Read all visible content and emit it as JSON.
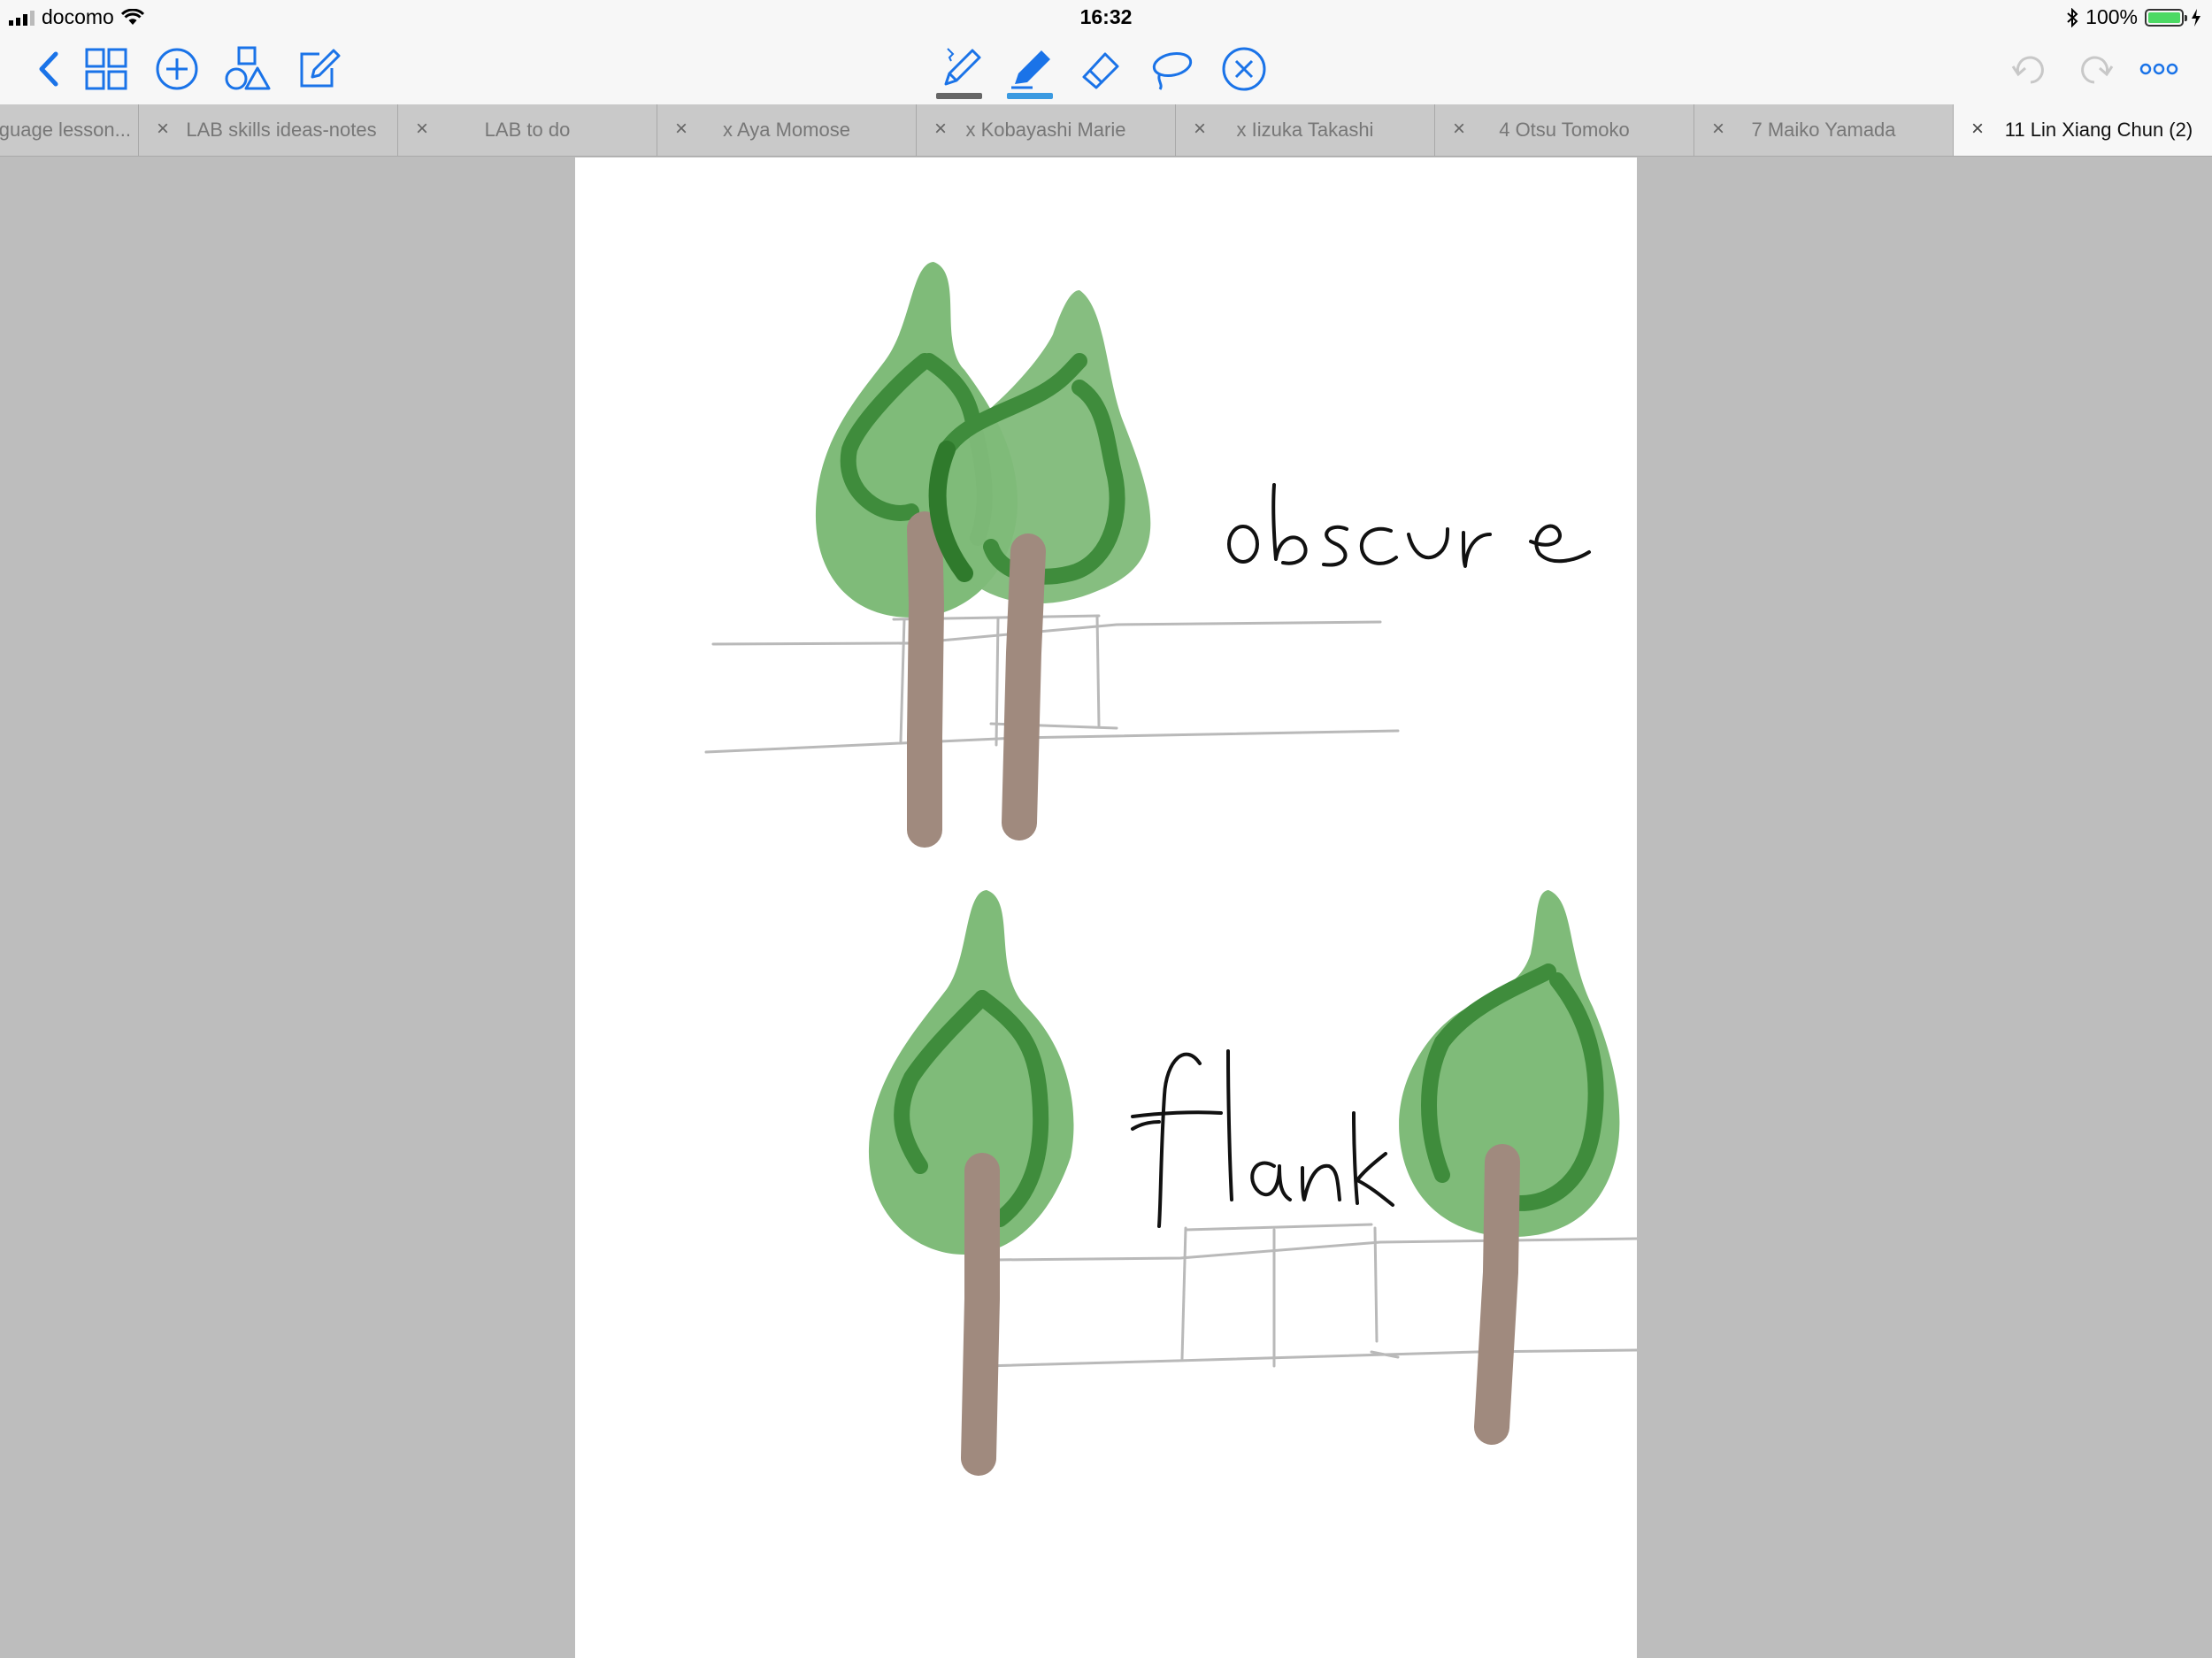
{
  "status_bar": {
    "carrier": "docomo",
    "time": "16:32",
    "battery": "100%"
  },
  "toolbar": {
    "buttons": {
      "back": "chevron-left-icon",
      "grid": "grid-icon",
      "add": "plus-circle-icon",
      "shapes": "shapes-icon",
      "edit": "compose-icon",
      "pen": "pen-icon",
      "highlighter": "highlighter-icon",
      "eraser": "eraser-icon",
      "lasso": "lasso-icon",
      "close_tool": "circle-x-icon",
      "undo": "undo-icon",
      "redo": "redo-icon",
      "more": "more-icon"
    },
    "colors": {
      "accent": "#1a73e8",
      "pen_underline": "#666666",
      "highlighter_underline": "#3b9ae1"
    }
  },
  "tabs": [
    {
      "label": "guage lesson...",
      "close": ""
    },
    {
      "label": "LAB skills ideas-notes",
      "close": "×"
    },
    {
      "label": "LAB to do",
      "close": "×"
    },
    {
      "label": "x Aya Momose",
      "close": "×"
    },
    {
      "label": "x Kobayashi Marie",
      "close": "×"
    },
    {
      "label": "x Iizuka Takashi",
      "close": "×"
    },
    {
      "label": "4 Otsu Tomoko",
      "close": "×"
    },
    {
      "label": "7 Maiko Yamada",
      "close": "×"
    },
    {
      "label": "11 Lin Xiang Chun (2)",
      "close": "×"
    }
  ],
  "canvas": {
    "words": [
      "obscure",
      "flank"
    ],
    "colors": {
      "leaf_light": "#7fbb79",
      "leaf_dark": "#3f8c3c",
      "trunk": "#a08a7e",
      "fence": "#b9b9b9",
      "ink": "#111111"
    }
  }
}
